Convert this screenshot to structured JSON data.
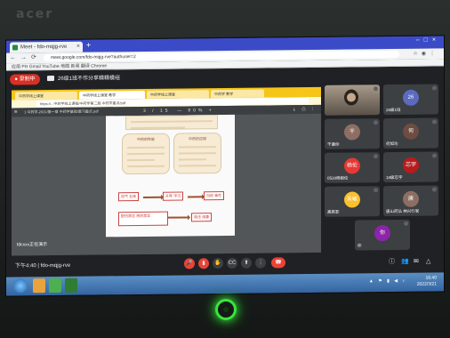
{
  "monitor": {
    "brand": "acer"
  },
  "browser": {
    "tab_title": "Meet - fdo-mqjg-rve",
    "url": "meet.google.com/fdo-mqjg-rve?authuser=2",
    "bookmarks": "应用  PH  Gmail  YouTube  地图  新闻  翻译  Chrome"
  },
  "meet": {
    "recording_label": "● 录制中",
    "meeting_title": "26级1班不作分享精精模组",
    "time_code": "下午4:40 | fdo-mqjg-rve",
    "presenter_label": "fdcxxx正在演示"
  },
  "inner_browser": {
    "tabs": [
      "中药学线上课堂",
      "中药学线上课堂 教学",
      "中药学线上课堂",
      "中药学 教学"
    ],
    "url": "https://...中药学线上课程/中药学第二版 中药学重点/pdf",
    "pdf_name": "1 中药学-2021/第一章 中药学基础/复习重点.pdf",
    "pdf_page": "3 / 15",
    "pdf_zoom": "—  80%  +"
  },
  "document": {
    "left_box_title": "中药的性能",
    "right_box_title": "中药的应用",
    "flow_boxes": [
      "四气 五味",
      "升降 浮沉",
      "归经 毒性",
      "配伍禁忌 用药禁忌",
      "用法 用量"
    ]
  },
  "participants": [
    {
      "name": "",
      "type": "photo"
    },
    {
      "name": "26级1班",
      "type": "avatar",
      "initial": "26",
      "color": "#5c6bc0"
    },
    {
      "name": "干谦你",
      "type": "avatar",
      "initial": "干",
      "color": "#8d6e63"
    },
    {
      "name": "何如功",
      "type": "avatar",
      "initial": "何",
      "color": "#6d4c41"
    },
    {
      "name": "0528杨姐伦",
      "type": "avatar",
      "initial": "杨伦",
      "color": "#e53935"
    },
    {
      "name": "18级芯宇",
      "type": "avatar",
      "initial": "芯宇",
      "color": "#b71c1c"
    },
    {
      "name": "高若菲",
      "type": "avatar",
      "initial": "朱敏",
      "color": "#fbc02d"
    },
    {
      "name": "唐山药弘 林兴行家",
      "type": "avatar",
      "initial": "唐",
      "color": "#8d6e63"
    },
    {
      "name": "你",
      "type": "avatar",
      "initial": "你",
      "color": "#8e24aa"
    }
  ],
  "controls": {
    "mic": "🎤",
    "cam": "▮",
    "hand": "✋",
    "cc": "CC",
    "present": "⬆",
    "more": "⋮",
    "end": "☎"
  },
  "taskbar": {
    "time": "16:40",
    "date": "2022/3/21"
  },
  "colors": {
    "accent": "#3b4bc8",
    "record": "#d93025",
    "end_call": "#ea4335",
    "power_led": "#39e63c"
  }
}
